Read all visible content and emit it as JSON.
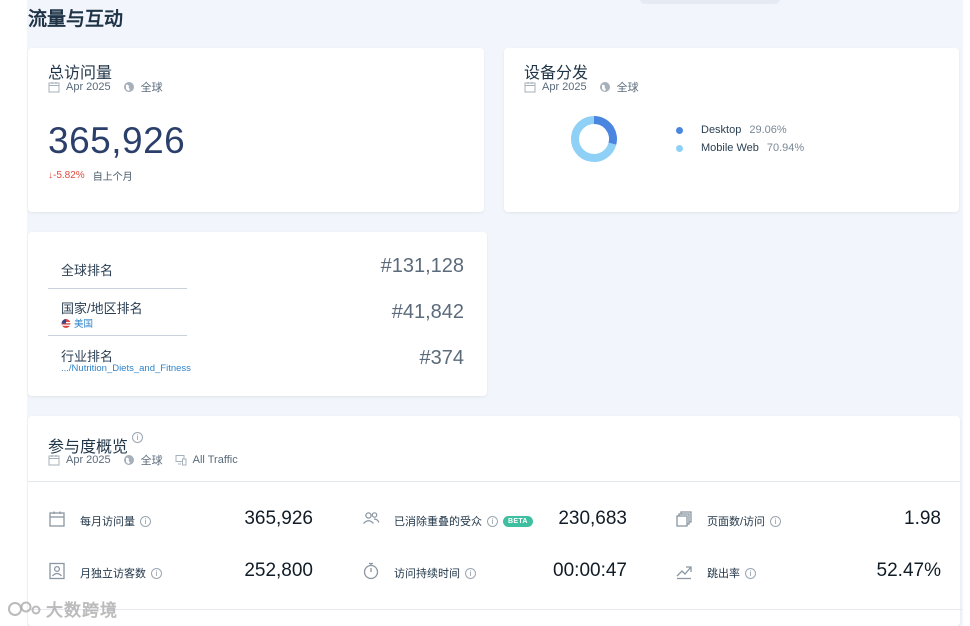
{
  "page": {
    "title": "流量与互动"
  },
  "total_visits": {
    "title": "总访问量",
    "date": "Apr 2025",
    "region": "全球",
    "value": "365,926",
    "change": "↓-5.82%",
    "change_label": "自上个月",
    "colors": {
      "value": "#2b3f6b",
      "negative": "#e0493c"
    }
  },
  "device": {
    "title": "设备分发",
    "date": "Apr 2025",
    "region": "全球",
    "items": [
      {
        "name": "Desktop",
        "pct": "29.06%",
        "value": 29.06,
        "color": "#4a86e0"
      },
      {
        "name": "Mobile Web",
        "pct": "70.94%",
        "value": 70.94,
        "color": "#8fd0f7"
      }
    ]
  },
  "ranks": [
    {
      "label": "全球排名",
      "value": "#131,128",
      "sub": ""
    },
    {
      "label": "国家/地区排名",
      "value": "#41,842",
      "sub": "美国",
      "sub_icon": "us-flag-icon"
    },
    {
      "label": "行业排名",
      "value": "#374",
      "sub": ".../Nutrition_Diets_and_Fitness"
    }
  ],
  "engagement": {
    "title": "参与度概览",
    "date": "Apr 2025",
    "region": "全球",
    "traffic": "All Traffic",
    "beta_label": "BETA",
    "metrics": [
      {
        "label": "每月访问量",
        "value": "365,926",
        "icon": "calendar-icon"
      },
      {
        "label": "已消除重叠的受众",
        "value": "230,683",
        "icon": "users-icon",
        "beta": true
      },
      {
        "label": "页面数/访问",
        "value": "1.98",
        "icon": "pages-icon"
      },
      {
        "label": "月独立访客数",
        "value": "252,800",
        "icon": "visitor-icon"
      },
      {
        "label": "访问持续时间",
        "value": "00:00:47",
        "icon": "timer-icon"
      },
      {
        "label": "跳出率",
        "value": "52.47%",
        "icon": "bounce-icon"
      }
    ]
  },
  "watermark": {
    "text": "大数跨境"
  }
}
